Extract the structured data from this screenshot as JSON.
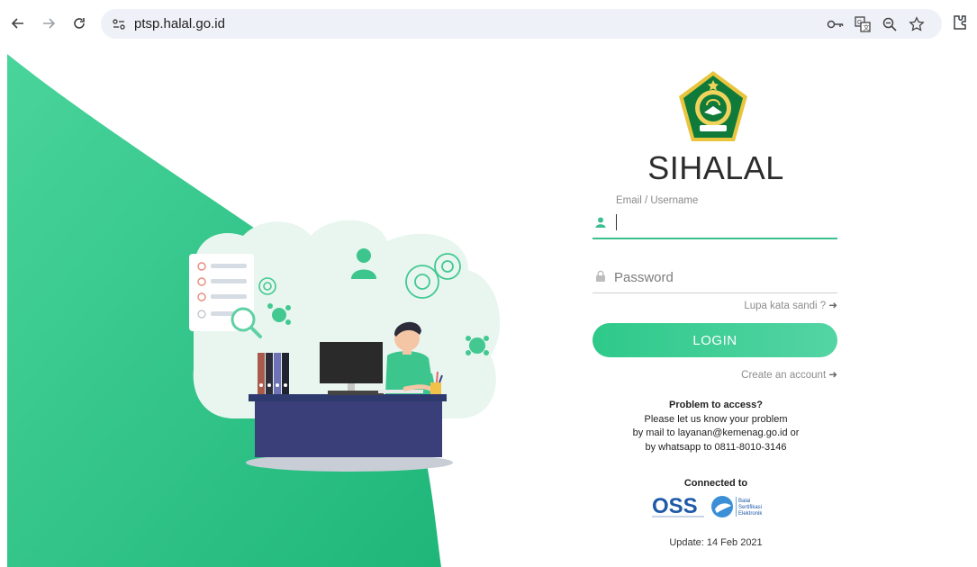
{
  "browser": {
    "url": "ptsp.halal.go.id"
  },
  "brand": {
    "title": "SIHALAL",
    "logo_icon": "kemenag-emblem-icon",
    "accent_color": "#2ec98a"
  },
  "login_form": {
    "username_label": "Email / Username",
    "username_value": "",
    "password_placeholder": "Password",
    "forgot_label": "Lupa kata sandi ?",
    "login_button": "LOGIN",
    "create_account_label": "Create an account"
  },
  "help": {
    "title": "Problem to access?",
    "line1": "Please let us know your problem",
    "line2": "by mail to layanan@kemenag.go.id or",
    "line3": "by whatsapp to 0811-8010-3146"
  },
  "footer": {
    "connected_label": "Connected to",
    "partner1": "OSS",
    "partner2_line1": "Balai",
    "partner2_line2": "Sertifikasi",
    "partner2_line3": "Elektronik",
    "update_label": "Update: 14 Feb 2021"
  }
}
